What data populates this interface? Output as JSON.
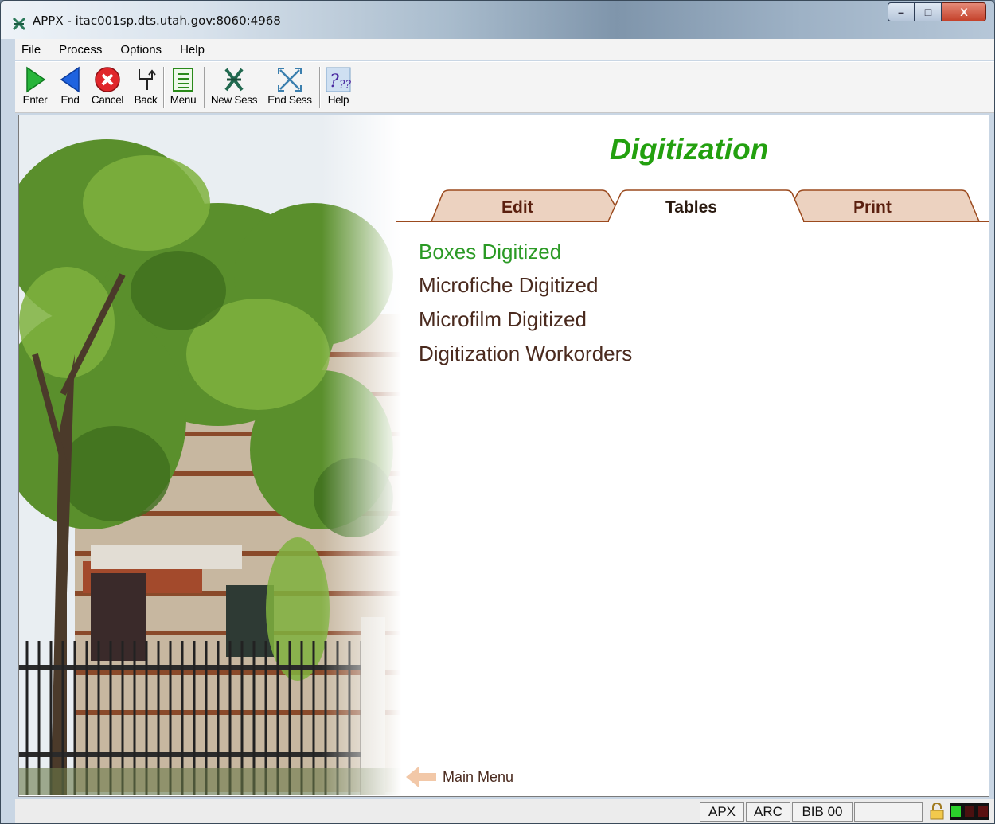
{
  "window": {
    "title": "APPX - itac001sp.dts.utah.gov:8060:4968",
    "min_label": "–",
    "max_label": "□",
    "close_label": "X"
  },
  "menubar": {
    "items": [
      "File",
      "Process",
      "Options",
      "Help"
    ]
  },
  "toolbar": {
    "buttons": [
      {
        "label": "Enter",
        "icon": "play-triangle-icon"
      },
      {
        "label": "End",
        "icon": "back-triangle-icon"
      },
      {
        "label": "Cancel",
        "icon": "cancel-x-icon"
      },
      {
        "label": "Back",
        "icon": "back-arrow-icon"
      },
      {
        "label": "Menu",
        "icon": "menu-list-icon"
      },
      {
        "label": "New Sess",
        "icon": "new-session-icon"
      },
      {
        "label": "End Sess",
        "icon": "end-session-icon"
      },
      {
        "label": "Help",
        "icon": "help-icon"
      }
    ]
  },
  "page": {
    "title": "Digitization",
    "tabs": [
      "Edit",
      "Tables",
      "Print"
    ],
    "active_tab": "Tables",
    "menu_items": [
      "Boxes Digitized",
      "Microfiche Digitized",
      "Microfilm Digitized",
      "Digitization Workorders"
    ],
    "active_item": "Boxes Digitized",
    "main_menu_label": "Main Menu"
  },
  "statusbar": {
    "fields": [
      "APX",
      "ARC",
      "BIB 00"
    ]
  },
  "colors": {
    "title_green": "#23a00f",
    "tab_fill": "#ecd2c0",
    "tab_border": "#9b4a1e",
    "item_brown": "#4a2a1e",
    "item_active": "#2b9a25"
  }
}
